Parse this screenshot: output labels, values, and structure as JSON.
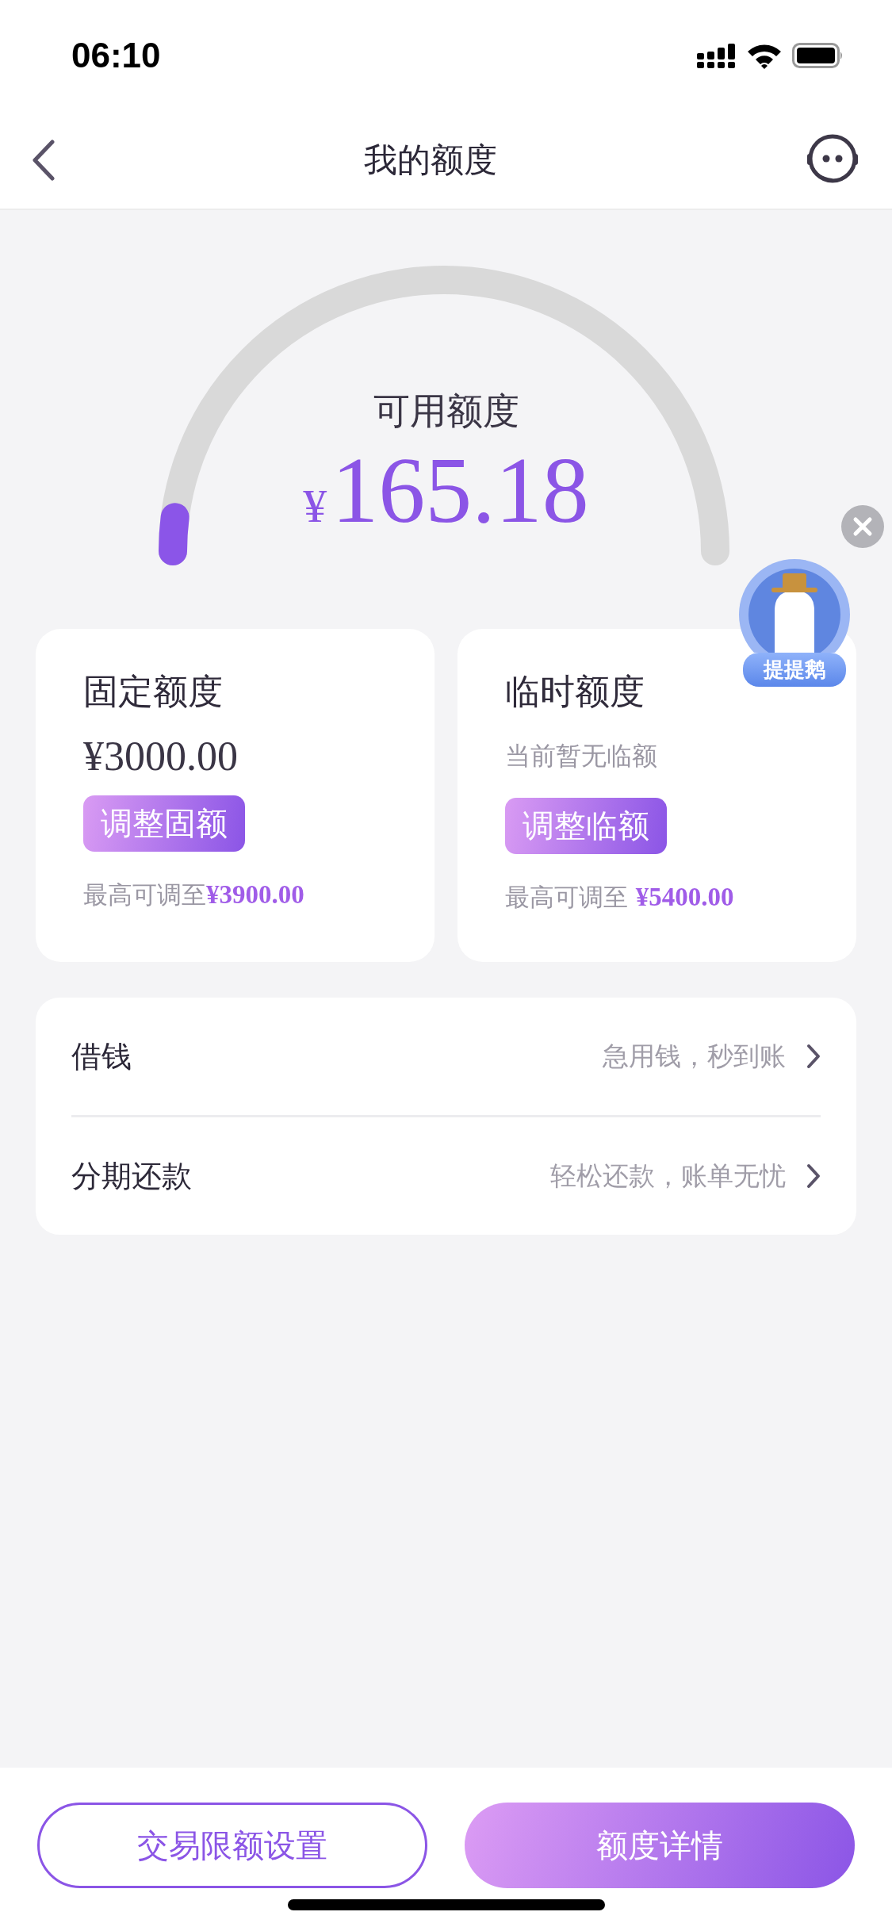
{
  "status_bar": {
    "time": "06:10"
  },
  "nav": {
    "title": "我的额度"
  },
  "gauge": {
    "label": "可用额度",
    "currency": "¥",
    "amount": "165.18"
  },
  "floating_badge": {
    "label": "提提鹅"
  },
  "cards": [
    {
      "title": "固定额度",
      "amount": "¥3000.00",
      "button": "调整固额",
      "footer": "最高可调至**¥3900.00**"
    },
    {
      "title": "临时额度",
      "note": "当前暂无临额",
      "button": "调整临额",
      "footer": "最高可调至 **¥5400.00**"
    }
  ],
  "menu": [
    {
      "label": "借钱",
      "hint": "急用钱，秒到账"
    },
    {
      "label": "分期还款",
      "hint": "轻松还款，账单无忧"
    }
  ],
  "bottom_buttons": [
    {
      "label": "交易限额设置",
      "kind": "outline"
    },
    {
      "label": "额度详情",
      "kind": "filled"
    }
  ]
}
